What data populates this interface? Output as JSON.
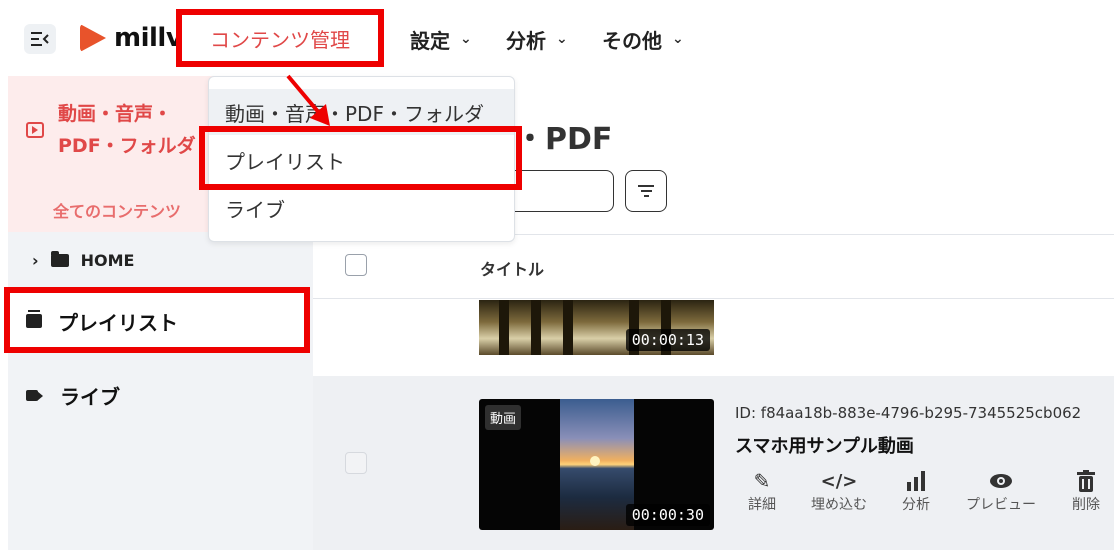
{
  "header": {
    "logo_text": "millv",
    "nav": [
      {
        "label": "コンテンツ管理"
      },
      {
        "label": "設定"
      },
      {
        "label": "分析"
      },
      {
        "label": "その他"
      }
    ]
  },
  "dropdown": {
    "items": [
      "動画・音声・PDF・フォルダ",
      "プレイリスト",
      "ライブ"
    ]
  },
  "sidebar": {
    "active_title": "動画・音声・\nPDF・フォルダ",
    "all_contents": "全てのコンテンツ",
    "home": "HOME",
    "playlist": "プレイリスト",
    "live": "ライブ"
  },
  "main": {
    "heading": "・PDF",
    "table": {
      "col_title": "タイトル",
      "rows": [
        {
          "duration": "00:00:13"
        },
        {
          "type_tag": "動画",
          "duration": "00:00:30",
          "id": "ID: f84aa18b-883e-4796-b295-7345525cb062",
          "title": "スマホ用サンプル動画",
          "actions": [
            {
              "label": "詳細",
              "icon": "pencil-icon"
            },
            {
              "label": "埋め込む",
              "icon": "code-icon"
            },
            {
              "label": "分析",
              "icon": "bar-chart-icon"
            },
            {
              "label": "プレビュー",
              "icon": "eye-icon"
            },
            {
              "label": "削除",
              "icon": "trash-icon"
            }
          ]
        }
      ]
    }
  },
  "colors": {
    "accent": "#e04848",
    "highlight_box": "#ee0000",
    "logo": "#e8532b"
  }
}
